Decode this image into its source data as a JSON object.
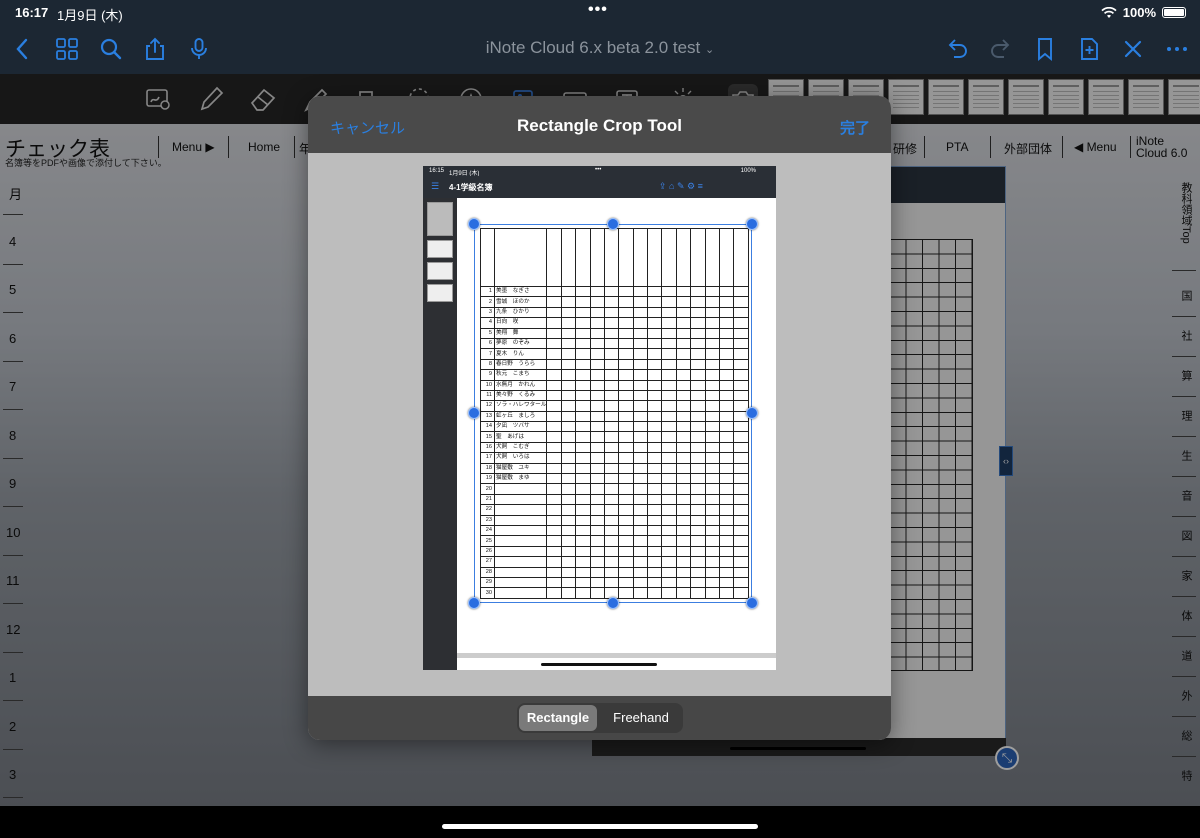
{
  "status_bar": {
    "time": "16:17",
    "date": "1月9日 (木)",
    "battery": "100%"
  },
  "nav_bar": {
    "title": "iNote Cloud 6.x beta 2.0 test",
    "accent_color": "#2a7fe0",
    "left_icons": [
      "back-chevron-icon",
      "grid-icon",
      "search-icon",
      "share-icon",
      "microphone-icon"
    ],
    "right_icons": [
      "undo-icon",
      "redo-icon",
      "bookmark-icon",
      "add-page-icon",
      "close-icon",
      "more-icon"
    ]
  },
  "background_page": {
    "title": "チェック表",
    "subtitle": "名簿等をPDFや画像で添付して下さい。",
    "tabs": [
      "Menu ▶",
      "Home",
      "年",
      "研修",
      "PTA",
      "外部団体",
      "◀ Menu"
    ],
    "app_label": "iNote Cloud 6.0",
    "months": [
      "月",
      "4",
      "5",
      "6",
      "7",
      "8",
      "9",
      "10",
      "11",
      "12",
      "1",
      "2",
      "3"
    ],
    "subjects": [
      "教科領域Top",
      "国",
      "社",
      "算",
      "理",
      "生",
      "音",
      "図",
      "家",
      "体",
      "道",
      "外",
      "総",
      "特"
    ]
  },
  "modal": {
    "title": "Rectangle Crop Tool",
    "cancel_label": "キャンセル",
    "done_label": "完了",
    "modes": [
      "Rectangle",
      "Freehand"
    ],
    "selected_mode": "Rectangle"
  },
  "preview": {
    "status_time": "16:15",
    "status_date": "1月9日 (木)",
    "status_battery": "100%",
    "title": "4-1学級名簿",
    "students": [
      {
        "no": "1",
        "name": "美墨　なぎさ"
      },
      {
        "no": "2",
        "name": "雪城　ほのか"
      },
      {
        "no": "3",
        "name": "九条　ひかり"
      },
      {
        "no": "4",
        "name": "日向　咲"
      },
      {
        "no": "5",
        "name": "美翔　舞"
      },
      {
        "no": "6",
        "name": "夢原　のぞみ"
      },
      {
        "no": "7",
        "name": "夏木　りん"
      },
      {
        "no": "8",
        "name": "春日野　うらら"
      },
      {
        "no": "9",
        "name": "秋元　こまち"
      },
      {
        "no": "10",
        "name": "水無月　かれん"
      },
      {
        "no": "11",
        "name": "美々野　くるみ"
      },
      {
        "no": "12",
        "name": "ソラ・ハレワタール"
      },
      {
        "no": "13",
        "name": "虹ヶ丘　ましろ"
      },
      {
        "no": "14",
        "name": "夕凪　ツバサ"
      },
      {
        "no": "15",
        "name": "聖　あげは"
      },
      {
        "no": "16",
        "name": "犬飼　こむぎ"
      },
      {
        "no": "17",
        "name": "犬飼　いろは"
      },
      {
        "no": "18",
        "name": "猫屋敷　ユキ"
      },
      {
        "no": "19",
        "name": "猫屋敷　まゆ"
      },
      {
        "no": "20",
        "name": ""
      },
      {
        "no": "21",
        "name": ""
      },
      {
        "no": "22",
        "name": ""
      },
      {
        "no": "23",
        "name": ""
      },
      {
        "no": "24",
        "name": ""
      },
      {
        "no": "25",
        "name": ""
      },
      {
        "no": "26",
        "name": ""
      },
      {
        "no": "27",
        "name": ""
      },
      {
        "no": "28",
        "name": ""
      },
      {
        "no": "29",
        "name": ""
      },
      {
        "no": "30",
        "name": ""
      }
    ]
  }
}
